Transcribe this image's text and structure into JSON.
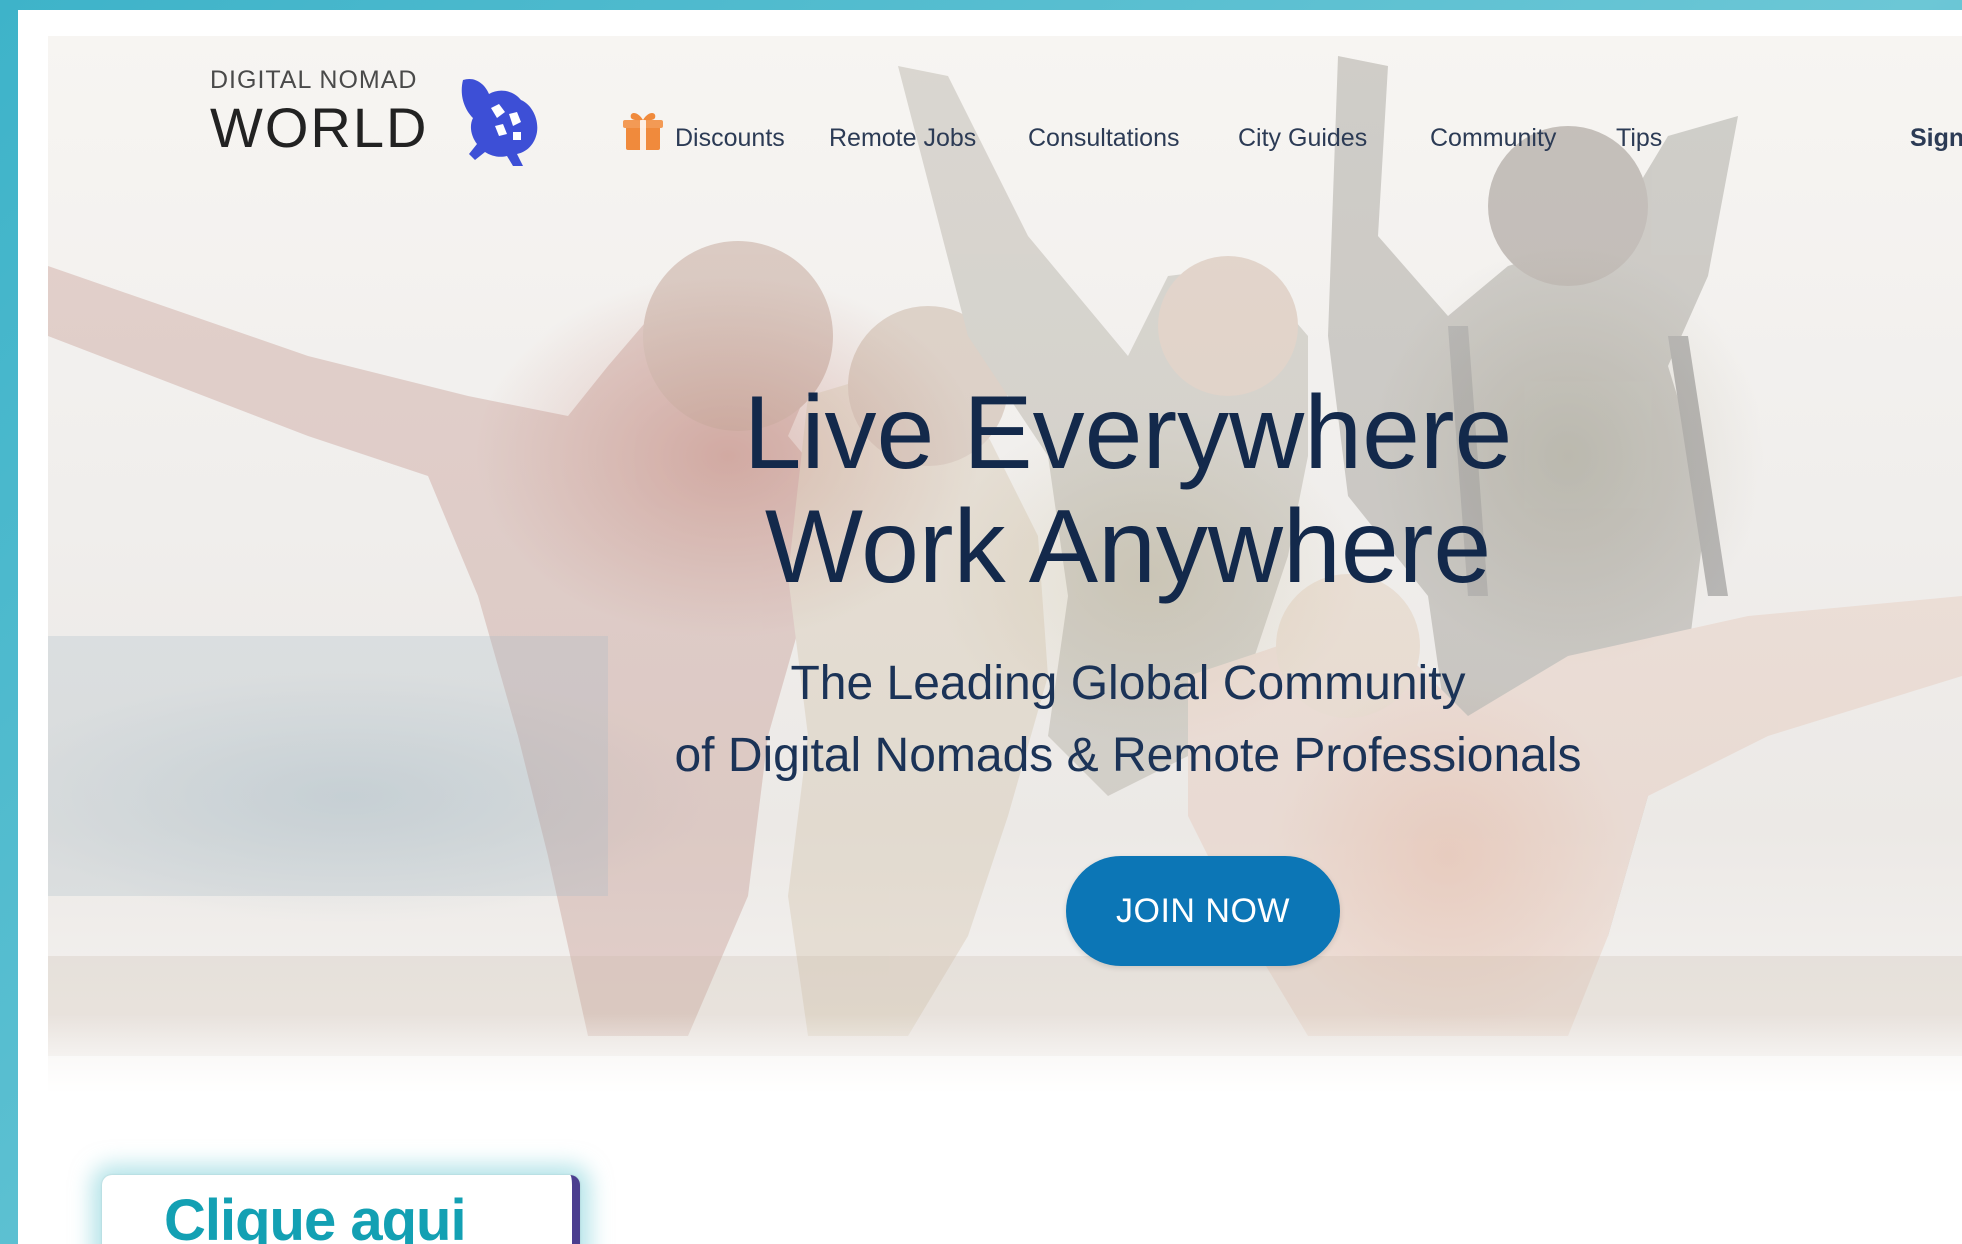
{
  "brand": {
    "small_text": "DIGITAL NOMAD",
    "big_text": "WORLD",
    "logo_icon": "turtle-logo-icon",
    "accent_color": "#3d4fd6"
  },
  "nav": {
    "items": [
      {
        "label": "Discounts",
        "icon": "gift-icon",
        "icon_color": "#f08a3c"
      },
      {
        "label": "Remote Jobs"
      },
      {
        "label": "Consultations"
      },
      {
        "label": "City Guides"
      },
      {
        "label": "Community"
      },
      {
        "label": "Tips"
      }
    ],
    "signin_label": "Sign"
  },
  "hero": {
    "headline_line1": "Live Everywhere",
    "headline_line2": "Work Anywhere",
    "subhead_line1": "The Leading Global Community",
    "subhead_line2": "of Digital Nomads & Remote Professionals",
    "cta_label": "JOIN NOW",
    "cta_color": "#0c76b6",
    "headline_color": "#13294b"
  },
  "promo": {
    "label": "Clique aqui",
    "color": "#13a0b3"
  }
}
